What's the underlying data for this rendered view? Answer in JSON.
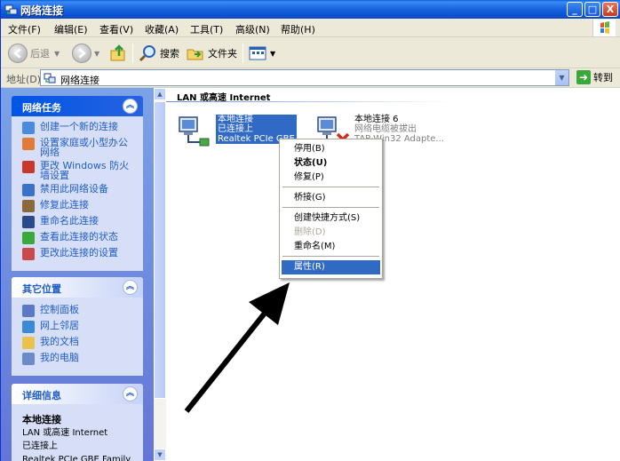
{
  "window": {
    "title": "网络连接",
    "colors": {
      "titlebar": "#0b4bc4",
      "taskpane": "#6375d6",
      "selection": "#316ac5"
    }
  },
  "title_buttons": {
    "minimize": "_",
    "maximize": "□",
    "close": "X"
  },
  "menu": [
    "文件(F)",
    "编辑(E)",
    "查看(V)",
    "收藏(A)",
    "工具(T)",
    "高级(N)",
    "帮助(H)"
  ],
  "toolbar": {
    "back": "后退",
    "search": "搜索",
    "folders": "文件夹"
  },
  "address": {
    "label": "地址(D)",
    "value": "网络连接",
    "go": "转到"
  },
  "taskpane": {
    "network_tasks": {
      "title": "网络任务",
      "items": [
        "创建一个新的连接",
        "设置家庭或小型办公网络",
        "更改 Windows 防火墙设置",
        "禁用此网络设备",
        "修复此连接",
        "重命名此连接",
        "查看此连接的状态",
        "更改此连接的设置"
      ]
    },
    "other_places": {
      "title": "其它位置",
      "items": [
        "控制面板",
        "网上邻居",
        "我的文档",
        "我的电脑"
      ]
    },
    "details": {
      "title": "详细信息",
      "name": "本地连接",
      "type": "LAN 或高速 Internet",
      "status": "已连接上",
      "device": "Realtek PCIe GBE Family"
    }
  },
  "content": {
    "section_title": "LAN 或高速 Internet",
    "connections": [
      {
        "name": "本地连接",
        "status": "已连接上",
        "device": "Realtek PCIe GBE"
      },
      {
        "name": "本地连接 6",
        "status": "网络电缆被拔出",
        "device": "TAP-Win32 Adapte..."
      }
    ]
  },
  "context_menu": {
    "items": [
      {
        "label": "停用(B)",
        "state": "normal"
      },
      {
        "label": "状态(U)",
        "state": "bold"
      },
      {
        "label": "修复(P)",
        "state": "normal"
      },
      {
        "label": "桥接(G)",
        "state": "normal"
      },
      {
        "label": "创建快捷方式(S)",
        "state": "normal"
      },
      {
        "label": "删除(D)",
        "state": "disabled"
      },
      {
        "label": "重命名(M)",
        "state": "normal"
      },
      {
        "label": "属性(R)",
        "state": "selected"
      }
    ]
  }
}
